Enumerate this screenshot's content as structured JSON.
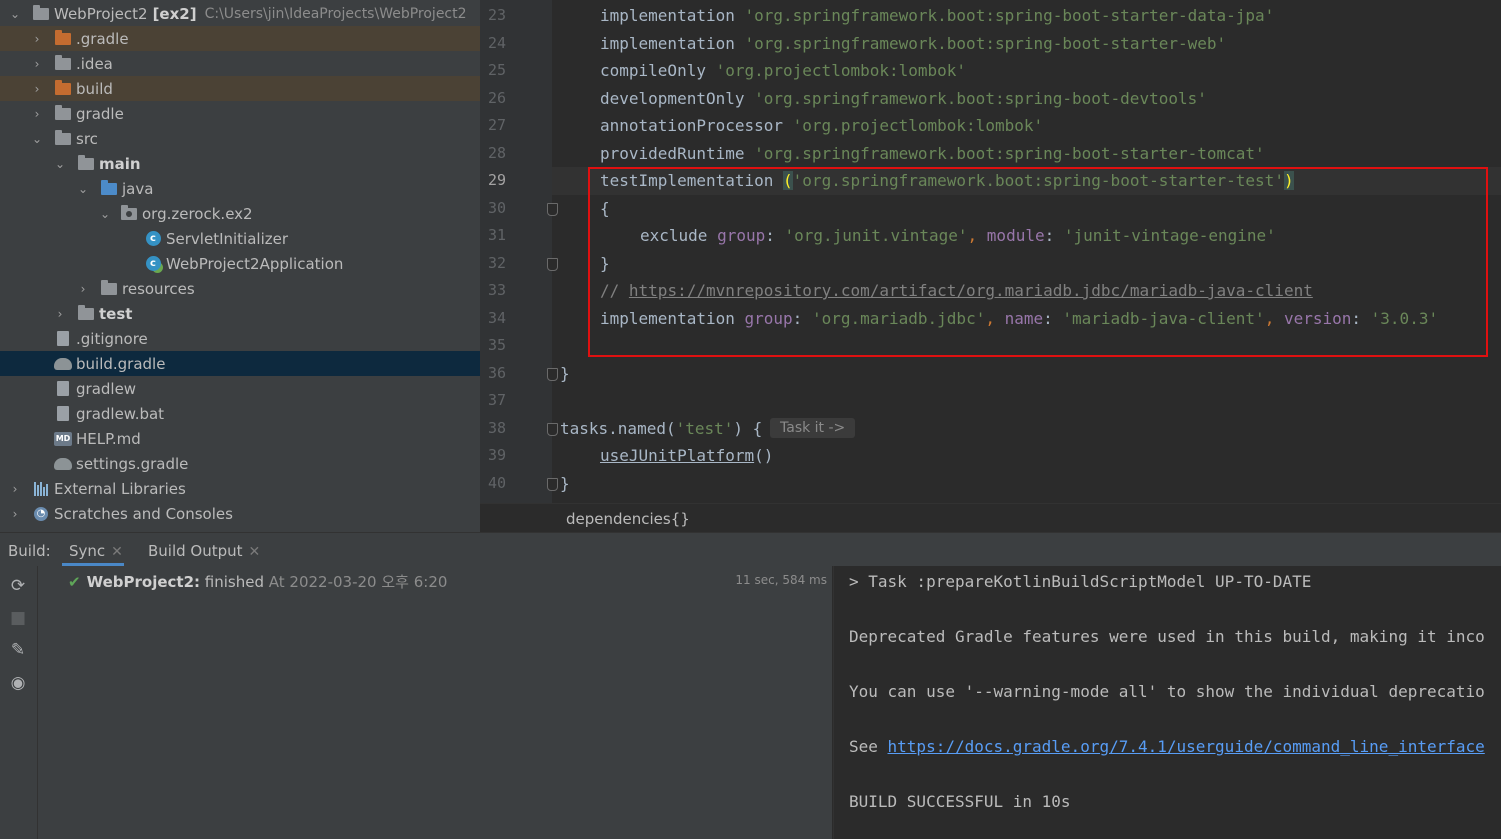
{
  "project_tree": {
    "root": {
      "name": "WebProject2",
      "module": "[ex2]",
      "path": "C:\\Users\\jin\\IdeaProjects\\WebProject2"
    },
    "items": [
      {
        "label": ".gradle"
      },
      {
        "label": ".idea"
      },
      {
        "label": "build"
      },
      {
        "label": "gradle"
      },
      {
        "label": "src"
      },
      {
        "label": "main"
      },
      {
        "label": "java"
      },
      {
        "label": "org.zerock.ex2"
      },
      {
        "label": "ServletInitializer"
      },
      {
        "label": "WebProject2Application"
      },
      {
        "label": "resources"
      },
      {
        "label": "test"
      },
      {
        "label": ".gitignore"
      },
      {
        "label": "build.gradle"
      },
      {
        "label": "gradlew"
      },
      {
        "label": "gradlew.bat"
      },
      {
        "label": "HELP.md"
      },
      {
        "label": "settings.gradle"
      },
      {
        "label": "External Libraries"
      },
      {
        "label": "Scratches and Consoles"
      }
    ]
  },
  "editor": {
    "line_numbers": [
      "23",
      "24",
      "25",
      "26",
      "27",
      "28",
      "29",
      "30",
      "31",
      "32",
      "33",
      "34",
      "35",
      "36",
      "37",
      "38",
      "39",
      "40"
    ],
    "lines": {
      "l23": {
        "fn": "implementation ",
        "str": "'org.springframework.boot:spring-boot-starter-data-jpa'"
      },
      "l24": {
        "fn": "implementation ",
        "str": "'org.springframework.boot:spring-boot-starter-web'"
      },
      "l25": {
        "fn": "compileOnly ",
        "str": "'org.projectlombok:lombok'"
      },
      "l26": {
        "fn": "developmentOnly ",
        "str": "'org.springframework.boot:spring-boot-devtools'"
      },
      "l27": {
        "fn": "annotationProcessor ",
        "str": "'org.projectlombok:lombok'"
      },
      "l28": {
        "fn": "providedRuntime ",
        "str": "'org.springframework.boot:spring-boot-starter-tomcat'"
      },
      "l29": {
        "fn": "testImplementation ",
        "open": "(",
        "str": "'org.springframework.boot:spring-boot-starter-test'",
        "close": ")"
      },
      "l30": {
        "text": "{"
      },
      "l31": {
        "fn": "exclude ",
        "k1": "group",
        "sep1": ": ",
        "v1": "'org.junit.vintage'",
        "comma": ", ",
        "k2": "module",
        "sep2": ": ",
        "v2": "'junit-vintage-engine'"
      },
      "l32": {
        "text": "}"
      },
      "l33": {
        "prefix": "// ",
        "url": "https://mvnrepository.com/artifact/org.mariadb.jdbc/mariadb-java-client"
      },
      "l34": {
        "fn": "implementation ",
        "k1": "group",
        "sep": ": ",
        "v1": "'org.mariadb.jdbc'",
        "comma": ", ",
        "k2": "name",
        "v2": "'mariadb-java-client'",
        "k3": "version",
        "v3": "'3.0.3'"
      },
      "l36": {
        "text": "}"
      },
      "l38": {
        "fn": "tasks.named(",
        "str": "'test'",
        "tail": ") {"
      },
      "l39": {
        "fn": "useJUnitPlatform",
        "tail": "()"
      },
      "l40": {
        "text": "}"
      }
    },
    "inlay_hint": "Task it ->",
    "breadcrumb": "dependencies{}"
  },
  "build_window": {
    "label": "Build:",
    "tabs": [
      {
        "label": "Sync"
      },
      {
        "label": "Build Output"
      }
    ],
    "sync": {
      "project": "WebProject2:",
      "status": "finished",
      "timestamp": "At 2022-03-20 오후 6:20",
      "duration": "11 sec, 584 ms"
    },
    "console": {
      "l1": "> Task :prepareKotlinBuildScriptModel UP-TO-DATE",
      "l2": "Deprecated Gradle features were used in this build, making it inco",
      "l3": "You can use '--warning-mode all' to show the individual deprecatio",
      "l4_prefix": "See ",
      "l4_link": "https://docs.gradle.org/7.4.1/userguide/command_line_interface",
      "l5": "BUILD SUCCESSFUL in 10s"
    }
  },
  "colors": {
    "highlight_box": "#e01010",
    "success_check": "#5fa659",
    "link": "#589df6"
  }
}
